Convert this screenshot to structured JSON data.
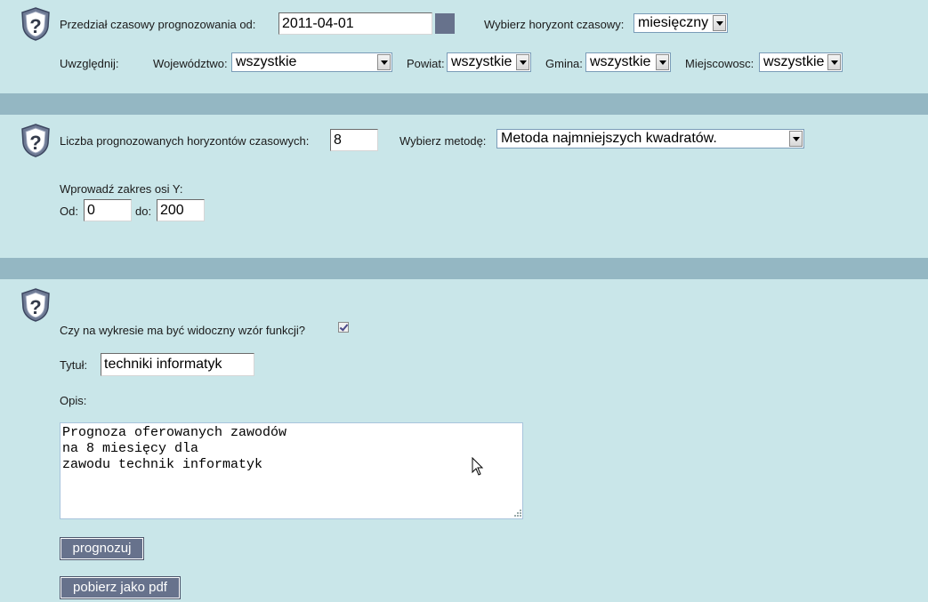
{
  "section1": {
    "range_label": "Przedział czasowy prognozowania od:",
    "date_value": "2011-04-01",
    "horizon_label": "Wybierz horyzont czasowy:",
    "horizon_value": "miesięczny",
    "include_label": "Uwzględnij:",
    "voivodeship_label": "Województwo:",
    "voivodeship_value": "wszystkie",
    "county_label": "Powiat:",
    "county_value": "wszystkie",
    "commune_label": "Gmina:",
    "commune_value": "wszystkie",
    "locality_label": "Miejscowosc:",
    "locality_value": "wszystkie"
  },
  "section2": {
    "count_label": "Liczba prognozowanych horyzontów czasowych:",
    "count_value": "8",
    "method_label": "Wybierz metodę:",
    "method_value": "Metoda najmniejszych kwadratów.",
    "yrange_label": "Wprowadź zakres osi Y:",
    "from_label": "Od:",
    "from_value": "0",
    "to_label": "do:",
    "to_value": "200"
  },
  "section3": {
    "formula_label": "Czy na wykresie ma być widoczny wzór funkcji?",
    "title_label": "Tytuł:",
    "title_value": "techniki informatyk",
    "desc_label": "Opis:",
    "desc_value": "Prognoza oferowanych zawodów\nna 8 miesięcy dla\nzawodu technik informatyk",
    "forecast_button": "prognozuj",
    "pdf_button": "pobierz jako pdf"
  },
  "colors": {
    "background": "#c9e6e9",
    "band": "#94b7c3",
    "button": "#67728c"
  }
}
